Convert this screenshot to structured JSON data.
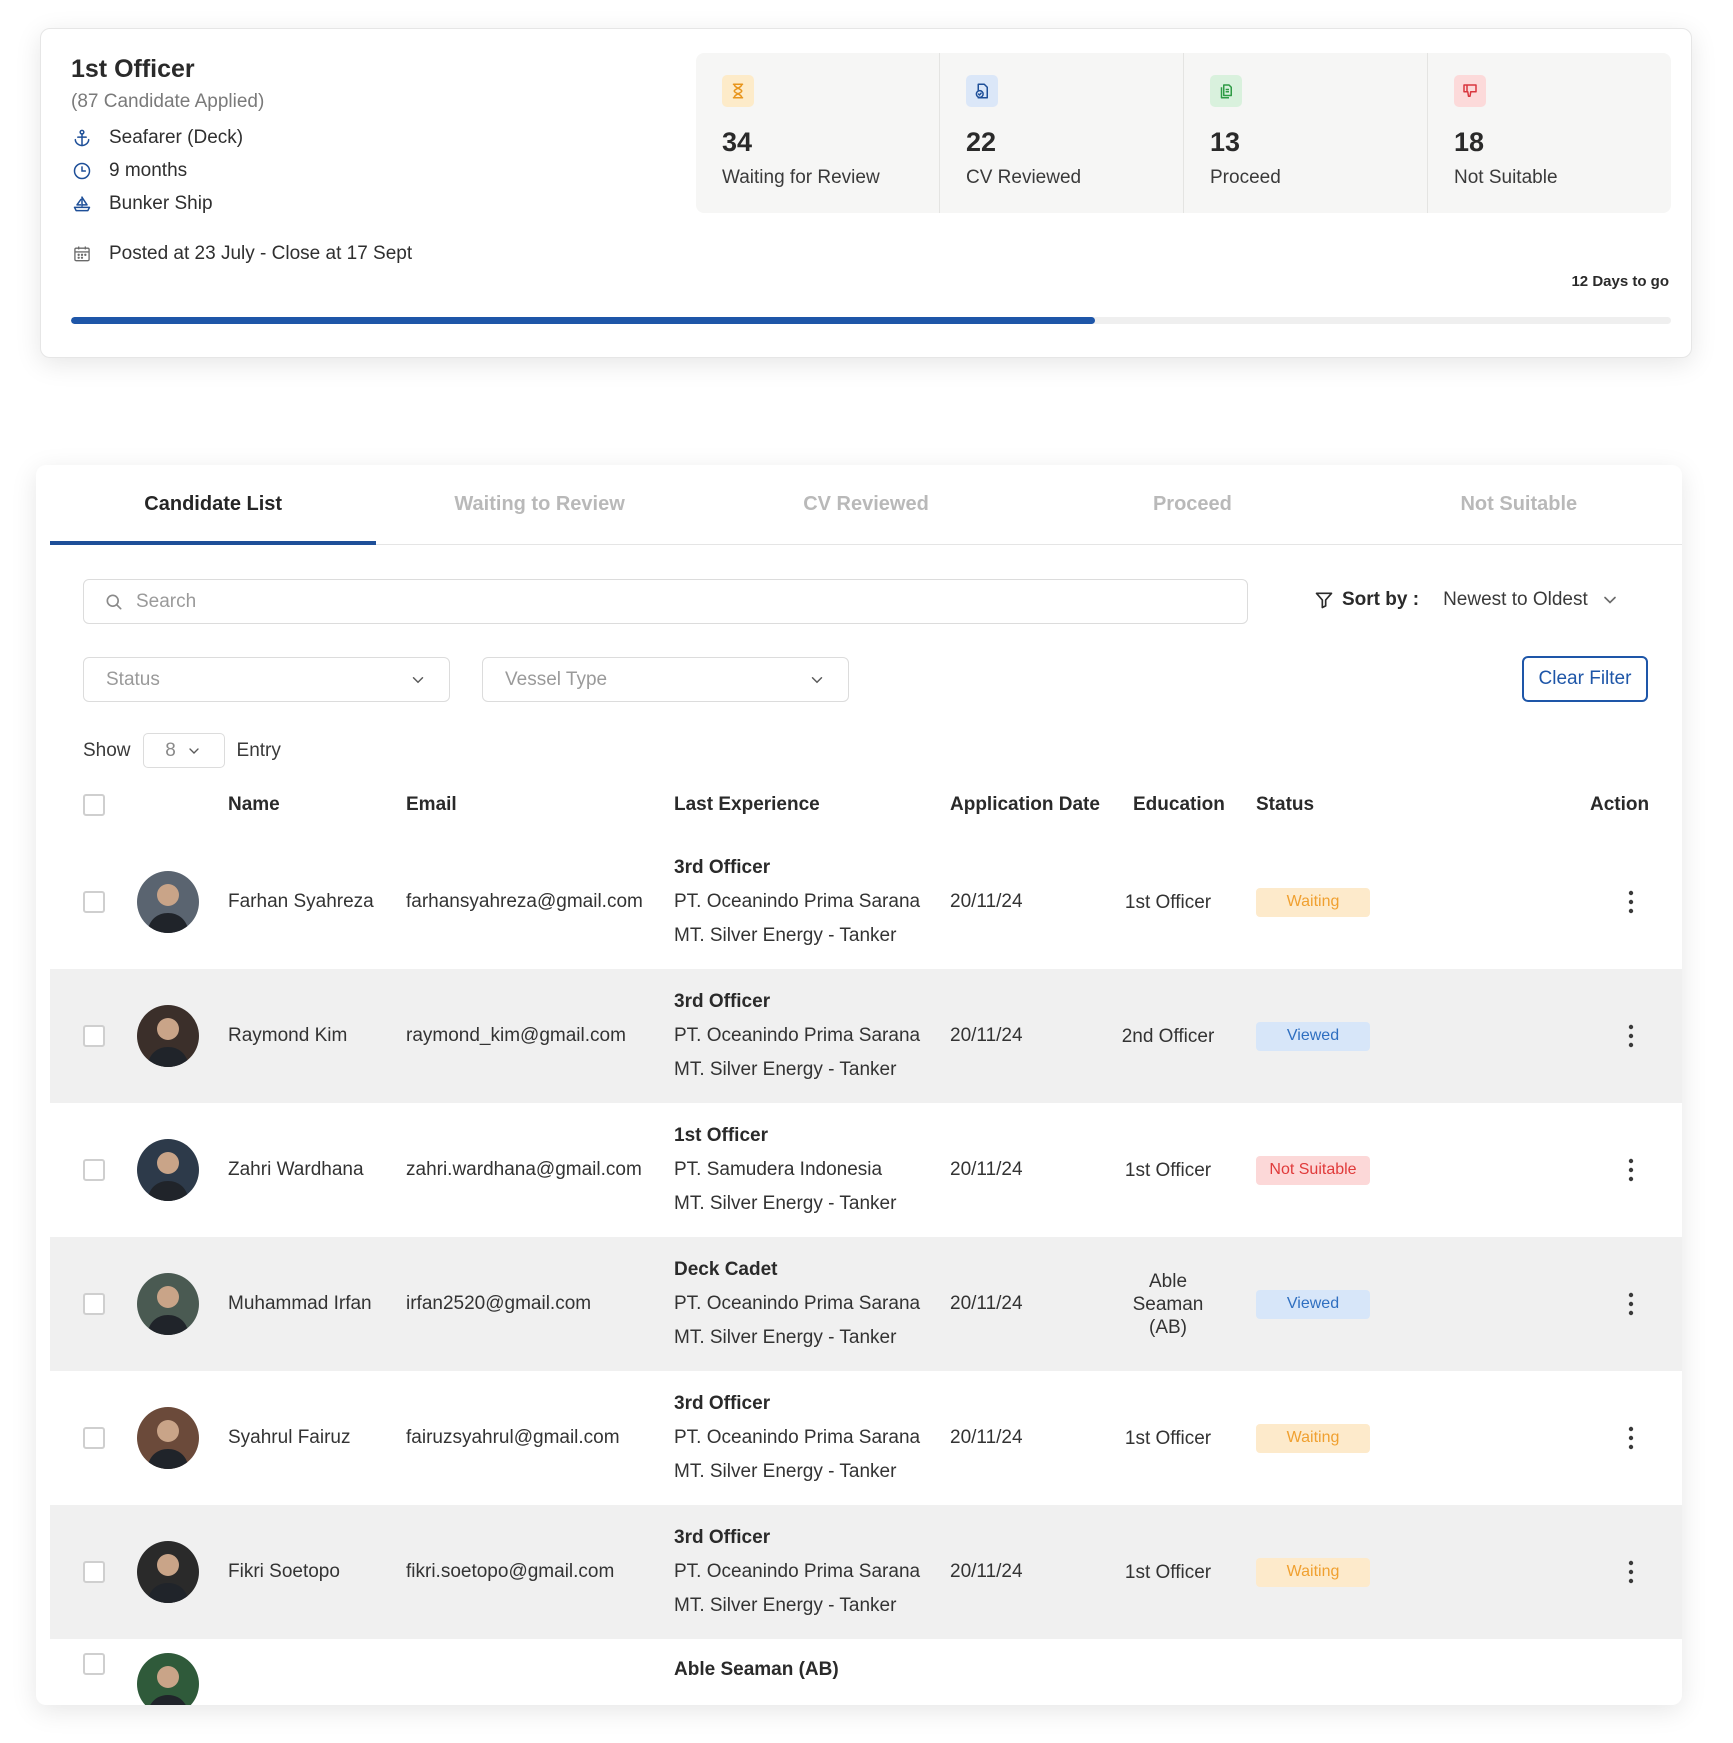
{
  "job": {
    "title": "1st Officer",
    "subtitle": "(87 Candidate Applied)",
    "category": "Seafarer (Deck)",
    "duration": "9 months",
    "vessel": "Bunker Ship",
    "posted": "Posted  at 23 July - Close at 17 Sept",
    "days_left": "12 Days to go",
    "progress_fraction": 0.64,
    "icons": {
      "category": "anchor-icon",
      "duration": "clock-icon",
      "vessel": "ship-icon",
      "posted": "calendar-icon"
    }
  },
  "stats": [
    {
      "value": "34",
      "label": "Waiting for Review",
      "icon": "hourglass-icon",
      "bg": "#fdebc9",
      "fg": "#e8951c"
    },
    {
      "value": "22",
      "label": "CV Reviewed",
      "icon": "document-check-icon",
      "bg": "#dbe7f8",
      "fg": "#1e4f98"
    },
    {
      "value": "13",
      "label": "Proceed",
      "icon": "documents-icon",
      "bg": "#d9f1dd",
      "fg": "#2f9b45"
    },
    {
      "value": "18",
      "label": "Not Suitable",
      "icon": "thumbs-down-icon",
      "bg": "#fcdada",
      "fg": "#d9363e"
    }
  ],
  "tabs": [
    "Candidate List",
    "Waiting to Review",
    "CV Reviewed",
    "Proceed",
    "Not Suitable"
  ],
  "active_tab": 0,
  "search": {
    "placeholder": "Search"
  },
  "sort": {
    "label": "Sort by :",
    "value": "Newest to Oldest"
  },
  "filters": {
    "status_placeholder": "Status",
    "vessel_placeholder": "Vessel Type",
    "clear_label": "Clear Filter"
  },
  "pagination": {
    "show_label": "Show",
    "entries": "8",
    "entry_label": "Entry"
  },
  "table": {
    "columns": [
      "Name",
      "Email",
      "Last Experience",
      "Application Date",
      "Education",
      "Status",
      "Action"
    ],
    "rows": [
      {
        "name": "Farhan Syahreza",
        "email": "farhansyahreza@gmail.com",
        "exp_role": "3rd Officer",
        "exp_company": "PT. Oceanindo Prima Sarana",
        "exp_vessel": "MT. Silver Energy - Tanker",
        "date": "20/11/24",
        "education": "1st Officer",
        "status": "Waiting"
      },
      {
        "name": "Raymond Kim",
        "email": "raymond_kim@gmail.com",
        "exp_role": "3rd Officer",
        "exp_company": "PT. Oceanindo Prima Sarana",
        "exp_vessel": "MT. Silver Energy - Tanker",
        "date": "20/11/24",
        "education": "2nd Officer",
        "status": "Viewed"
      },
      {
        "name": "Zahri Wardhana",
        "email": "zahri.wardhana@gmail.com",
        "exp_role": "1st Officer",
        "exp_company": "PT. Samudera Indonesia",
        "exp_vessel": "MT. Silver Energy - Tanker",
        "date": "20/11/24",
        "education": "1st Officer",
        "status": "Not Suitable"
      },
      {
        "name": "Muhammad Irfan",
        "email": "irfan2520@gmail.com",
        "exp_role": "Deck Cadet",
        "exp_company": "PT. Oceanindo Prima Sarana",
        "exp_vessel": "MT. Silver Energy - Tanker",
        "date": "20/11/24",
        "education": "Able Seaman (AB)",
        "status": "Viewed"
      },
      {
        "name": "Syahrul  Fairuz",
        "email": "fairuzsyahrul@gmail.com",
        "exp_role": "3rd Officer",
        "exp_company": "PT. Oceanindo Prima Sarana",
        "exp_vessel": "MT. Silver Energy - Tanker",
        "date": "20/11/24",
        "education": "1st Officer",
        "status": "Waiting"
      },
      {
        "name": "Fikri Soetopo",
        "email": "fikri.soetopo@gmail.com",
        "exp_role": "3rd Officer",
        "exp_company": "PT. Oceanindo Prima Sarana",
        "exp_vessel": "MT. Silver Energy - Tanker",
        "date": "20/11/24",
        "education": "1st Officer",
        "status": "Waiting"
      },
      {
        "name": "",
        "email": "",
        "exp_role": "Able Seaman (AB)",
        "exp_company": "",
        "exp_vessel": "",
        "date": "",
        "education": "",
        "status": ""
      }
    ]
  },
  "status_colors": {
    "Waiting": {
      "bg": "#fdeacb",
      "fg": "#f0a030"
    },
    "Viewed": {
      "bg": "#d7e6f9",
      "fg": "#2f6fc0"
    },
    "Not Suitable": {
      "bg": "#fcd8d8",
      "fg": "#e03a3a"
    }
  },
  "avatar_palette": [
    "#5a6470",
    "#3b2f2a",
    "#2d3a4a",
    "#4a5a52",
    "#6b4a3a",
    "#2a2a2a",
    "#2f5a3a"
  ]
}
